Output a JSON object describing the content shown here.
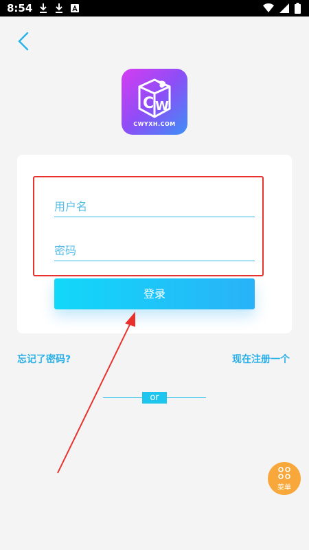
{
  "status_bar": {
    "time": "8:54",
    "icons": [
      "download-icon",
      "download-icon",
      "photo-icon",
      "wifi-icon",
      "signal-icon",
      "battery-icon"
    ]
  },
  "logo": {
    "text": "CWYXH.COM"
  },
  "login_form": {
    "username_placeholder": "用户名",
    "password_placeholder": "密码",
    "login_label": "登录"
  },
  "links": {
    "forgot_password": "忘记了密码?",
    "register": "现在注册一个"
  },
  "divider": {
    "label": "or"
  },
  "menu": {
    "label": "菜单"
  },
  "colors": {
    "accent": "#2cb0e8",
    "button_start": "#12d8f9",
    "button_end": "#29b2f8",
    "menu": "#f8a83a",
    "highlight": "#e8312d"
  }
}
